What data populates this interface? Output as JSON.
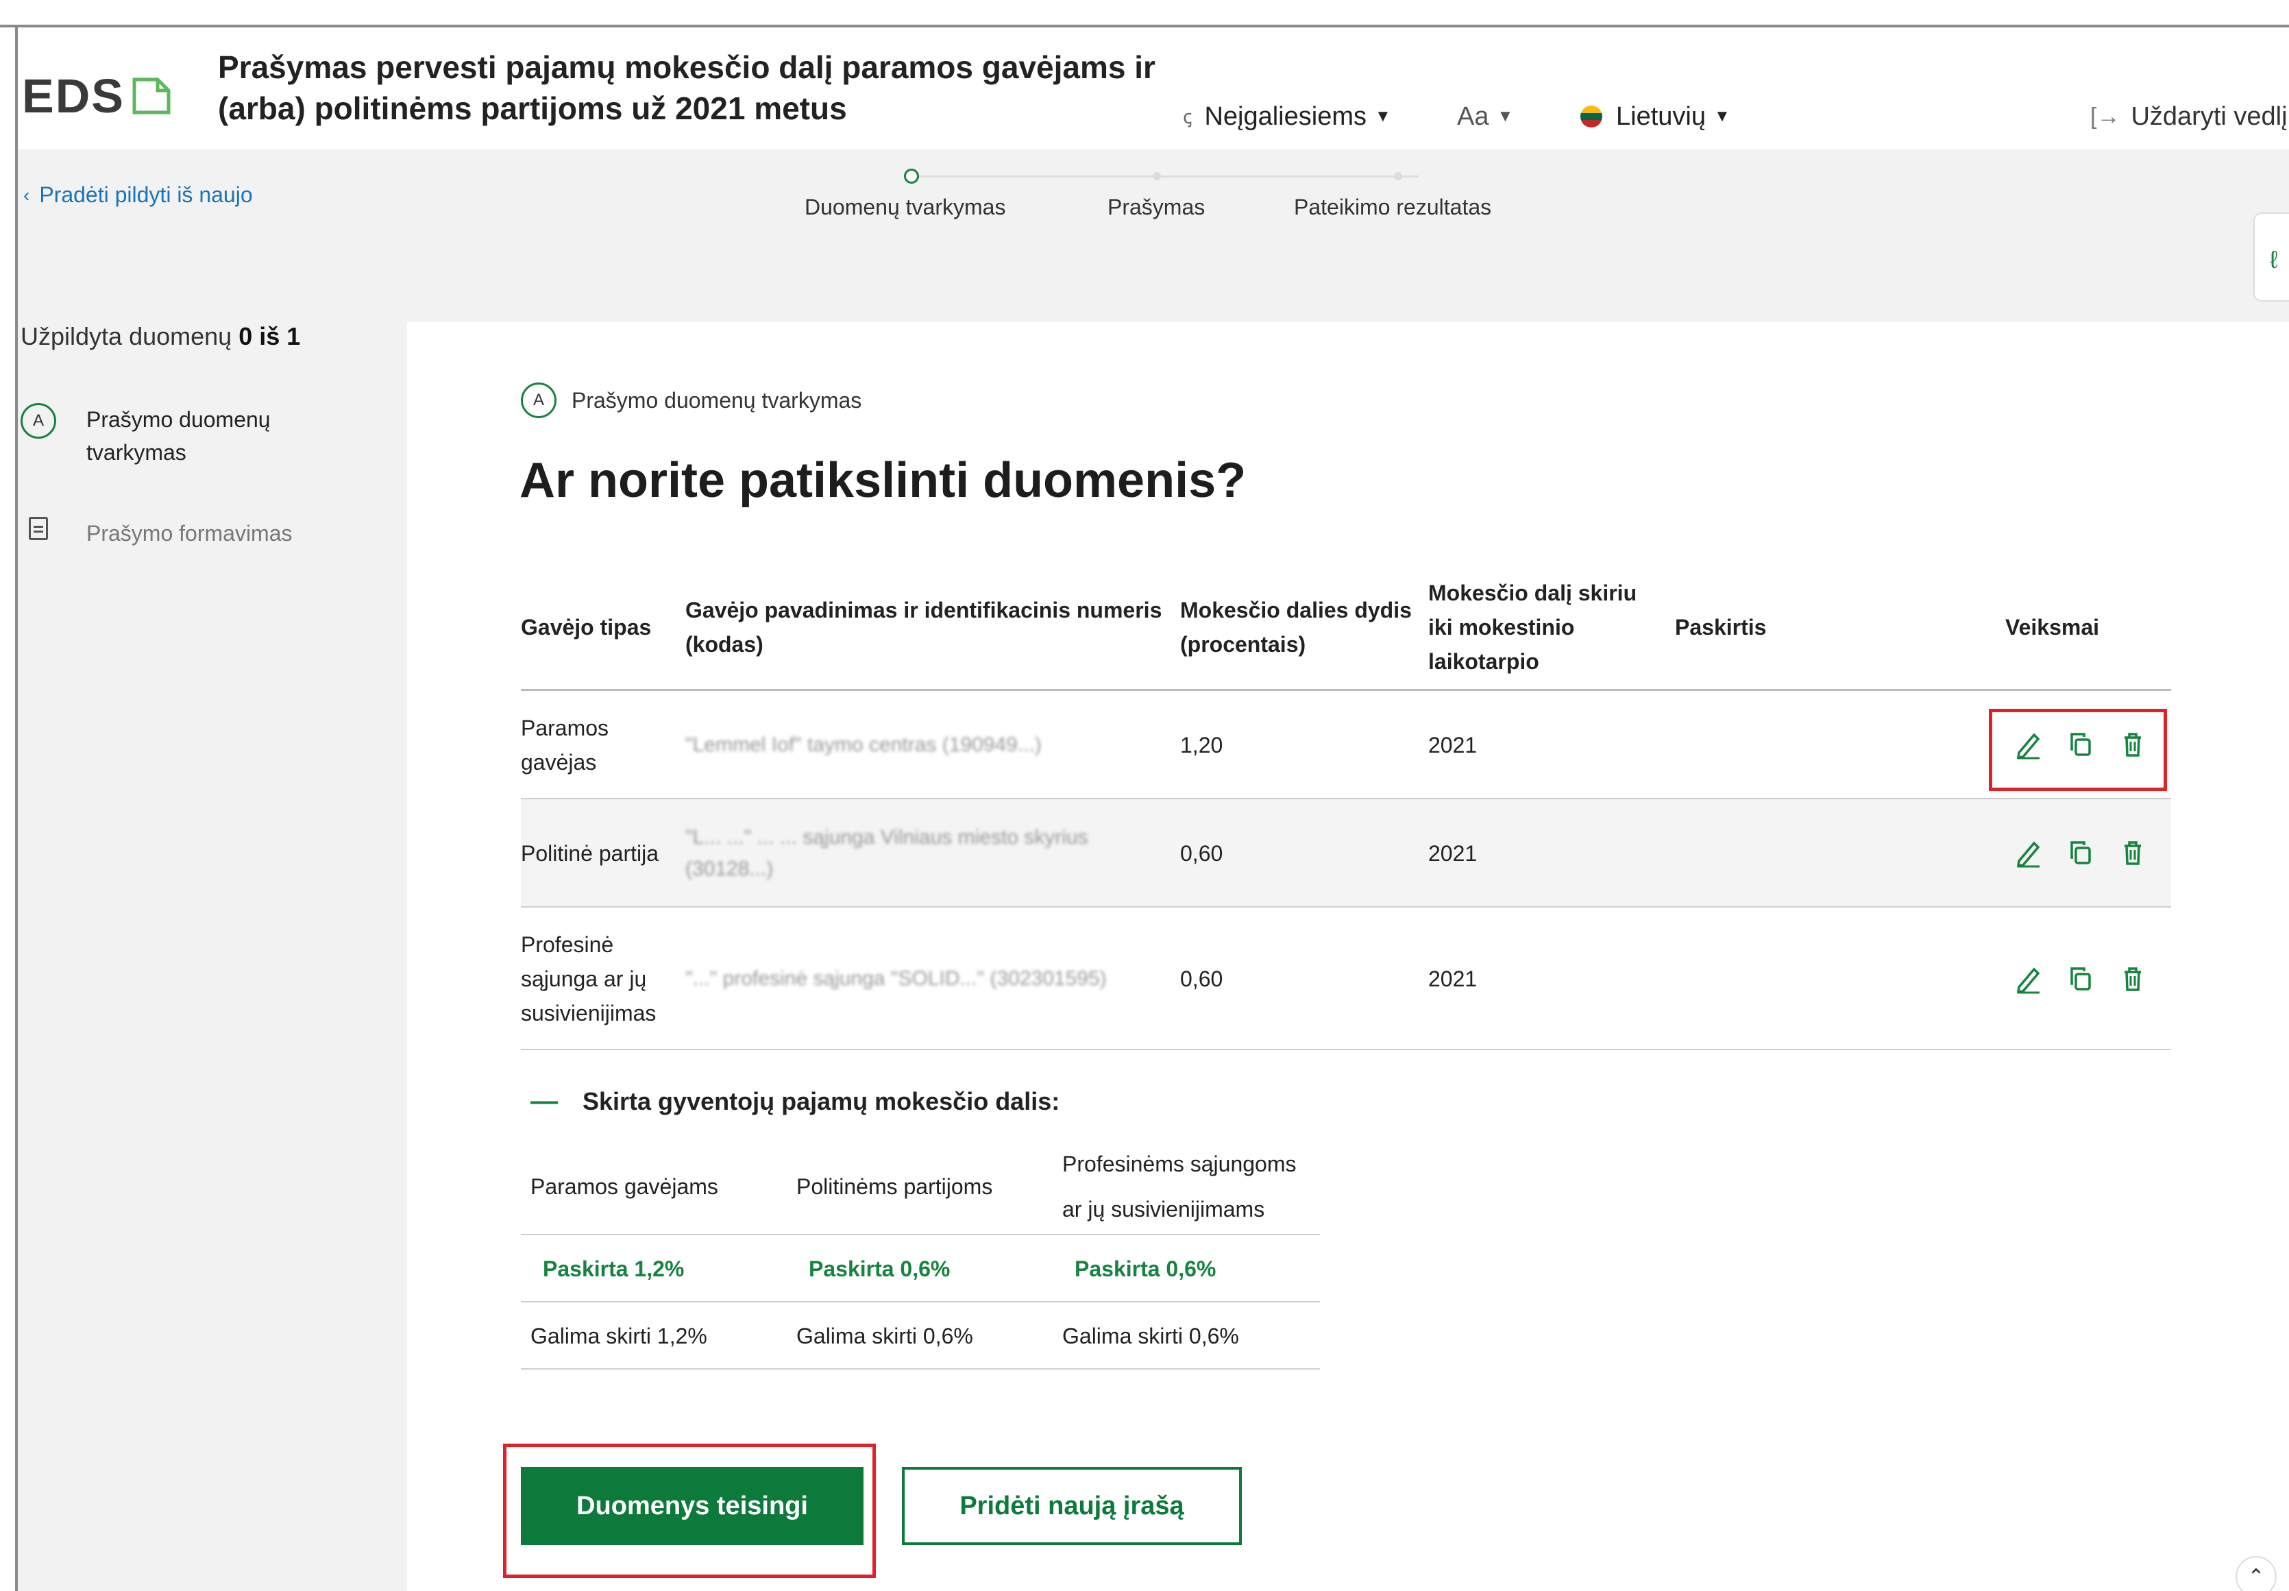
{
  "header": {
    "logo_text": "EDS",
    "title": "Prašymas pervesti pajamų mokesčio dalį paramos gavėjams ir (arba) politinėms partijoms už 2021 metus",
    "accessibility_label": "Neįgaliesiems",
    "fontsize_label": "Aa",
    "language_label": "Lietuvių",
    "close_label": "Uždaryti vedlį"
  },
  "stepper": {
    "back_label": "Pradėti pildyti iš naujo",
    "steps": [
      {
        "label": "Duomenų tvarkymas"
      },
      {
        "label": "Prašymas"
      },
      {
        "label": "Pateikimo rezultatas"
      }
    ]
  },
  "sidebar": {
    "status_prefix": "Užpildyta duomenų",
    "status_count": "0 iš 1",
    "items": [
      {
        "badge": "A",
        "label": "Prašymo duomenų tvarkymas"
      },
      {
        "label": "Prašymo formavimas"
      }
    ]
  },
  "main": {
    "section_badge": "A",
    "section_label": "Prašymo duomenų tvarkymas",
    "title": "Ar norite patikslinti duomenis?",
    "table": {
      "headers": [
        "Gavėjo tipas",
        "Gavėjo pavadinimas ir identifikacinis numeris (kodas)",
        "Mokesčio dalies dydis (procentais)",
        "Mokesčio dalį skiriu iki mokestinio laikotarpio",
        "Paskirtis",
        "Veiksmai"
      ],
      "rows": [
        {
          "type": "Paramos gavėjas",
          "name": "\"Lemmel Iof\" taymo centras (190949...)",
          "percent": "1,20",
          "period": "2021",
          "purpose": ""
        },
        {
          "type": "Politinė partija",
          "name": "\"L... ...\" ... ... sąjunga Vilniaus miesto skyrius (30128...)",
          "percent": "0,60",
          "period": "2021",
          "purpose": ""
        },
        {
          "type": "Profesinė sąjunga ar jų susivienijimas",
          "name": "\"...\" profesinė sąjunga \"SOLID...\" (302301595)",
          "percent": "0,60",
          "period": "2021",
          "purpose": ""
        }
      ]
    },
    "summary": {
      "title": "Skirta gyventojų pajamų mokesčio dalis:",
      "headers": [
        "Paramos gavėjams",
        "Politinėms partijoms",
        "Profesinėms sąjungoms ar jų susivienijimams"
      ],
      "assigned": [
        "Paskirta 1,2%",
        "Paskirta 0,6%",
        "Paskirta 0,6%"
      ],
      "available": [
        "Galima skirti 1,2%",
        "Galima skirti 0,6%",
        "Galima skirti 0,6%"
      ]
    },
    "buttons": {
      "confirm": "Duomenys teisingi",
      "add": "Pridėti naują įrašą"
    }
  },
  "colors": {
    "accent_green": "#0c7a3a",
    "link_blue": "#1a73b8",
    "highlight_red": "#e0202a"
  }
}
